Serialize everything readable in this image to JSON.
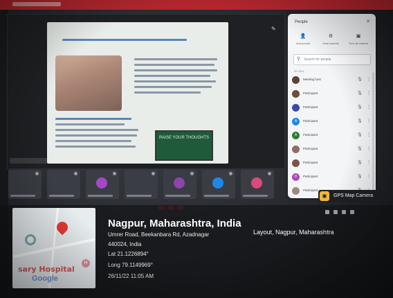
{
  "people_panel": {
    "title": "People",
    "close_icon": "close-icon",
    "actions": [
      {
        "label": "Add people",
        "icon": "person-add-icon"
      },
      {
        "label": "Host controls",
        "icon": "host-controls-icon"
      },
      {
        "label": "Turn off camera",
        "icon": "camera-icon"
      }
    ],
    "search_placeholder": "Search for people",
    "section_label": "IN CALL",
    "participants": [
      {
        "name": "Meeting host",
        "initial": "",
        "color": "#5d4037"
      },
      {
        "name": "Participant",
        "initial": "",
        "color": "#6d4c41"
      },
      {
        "name": "Participant",
        "initial": "",
        "color": "#3949ab"
      },
      {
        "name": "Participant",
        "initial": "A",
        "color": "#1e88e5"
      },
      {
        "name": "Participant",
        "initial": "A",
        "color": "#2e7d32"
      },
      {
        "name": "Participant",
        "initial": "",
        "color": "#8d6e63"
      },
      {
        "name": "Participant",
        "initial": "",
        "color": "#795548"
      },
      {
        "name": "Participant",
        "initial": "D",
        "color": "#ab47bc"
      },
      {
        "name": "Participant",
        "initial": "",
        "color": "#a1887f"
      }
    ]
  },
  "slide": {
    "board_text": "RAISE YOUR THOUGHTS"
  },
  "tiles": [
    {
      "color": "#3a3d44",
      "dot": ""
    },
    {
      "color": "#3a3d44",
      "dot": ""
    },
    {
      "color": "#3a3d44",
      "dot": "#a646c9"
    },
    {
      "color": "#3a3d44",
      "dot": ""
    },
    {
      "color": "#3a3d44",
      "dot": "#8e44ad"
    },
    {
      "color": "#3a3d44",
      "dot": "#1e88e5"
    },
    {
      "color": "#3a3d44",
      "dot": "#d84a7a"
    }
  ],
  "gps_overlay": {
    "app_name": "GPS Map Camera",
    "city": "Nagpur, Maharashtra, India",
    "address_line": "Umrer Road, Beekanbara Rd, Azadnagar",
    "address_line_2": "Layout, Nagpur, Maharashtra",
    "pincode": "440024, India",
    "latitude": "Lat 21.1226894°",
    "longitude": "Long 79.1149969°",
    "datetime": "26/11/22 11:05 AM",
    "map_labels": {
      "hospital": "sary Hospital",
      "google": "Google",
      "hospital_badge": "H"
    }
  }
}
